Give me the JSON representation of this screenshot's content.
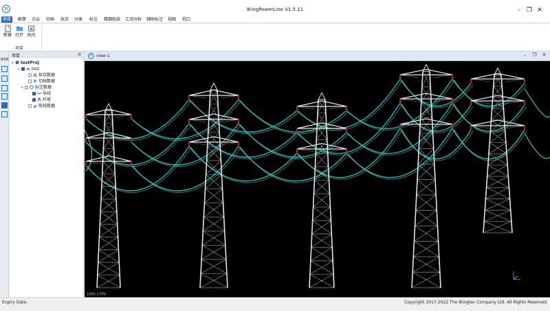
{
  "app": {
    "title": "IKingPowerLine V1.5.11",
    "logo": "R"
  },
  "menu": [
    "项目",
    "解算",
    "点云",
    "切档",
    "拟合",
    "分类",
    "标注",
    "精细航线",
    "工况分析",
    "辅助标注",
    "视图",
    "视口"
  ],
  "ribbon": {
    "buttons": [
      {
        "label": "新建",
        "icon": "new-project-icon"
      },
      {
        "label": "打开",
        "icon": "open-folder-icon"
      },
      {
        "label": "关闭",
        "icon": "close-project-icon"
      }
    ],
    "group_label": "项目"
  },
  "left_toolbar": {
    "label": "RSK"
  },
  "project_panel": {
    "title": "项目",
    "tree": [
      {
        "label": "testProj",
        "level": 0,
        "bold": true
      },
      {
        "label": "test",
        "level": 1
      },
      {
        "label": "拟合数据",
        "level": 2
      },
      {
        "label": "切档数据",
        "level": 2
      },
      {
        "label": "标注数据",
        "level": 2
      },
      {
        "label": "导线",
        "level": 3
      },
      {
        "label": "杆塔",
        "level": 3
      },
      {
        "label": "航线数据",
        "level": 2
      }
    ]
  },
  "view": {
    "title": "view-1",
    "fps": "1000.1 FPS"
  },
  "status": {
    "left": "Expiry Date:",
    "right": "Copyright 2017-2022 The IKingtec Company Ltd. All Rights Reserved."
  },
  "colors": {
    "accent": "#2b6cb0",
    "wire": "#3fc6c2",
    "tower": "#e6e6e6",
    "insulator": "#c21f1f",
    "background": "#000000"
  }
}
